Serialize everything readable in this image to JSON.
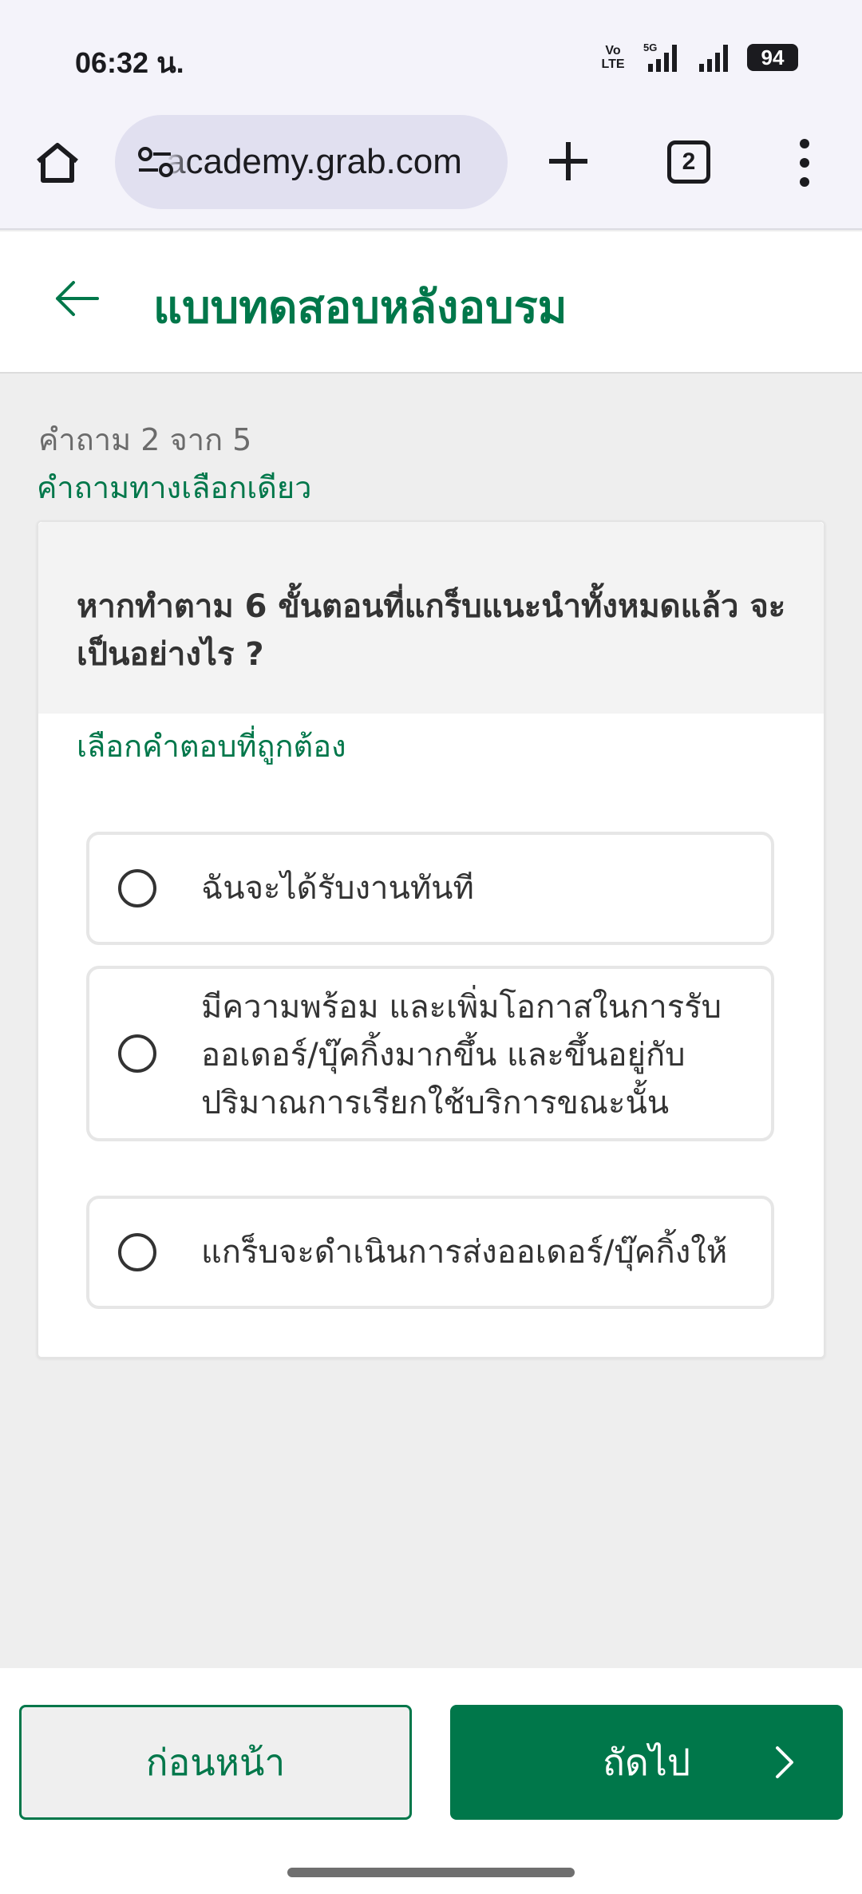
{
  "status_bar": {
    "time": "06:32 น.",
    "volte_label": "Vo LTE",
    "network": "5G",
    "battery": "94"
  },
  "browser": {
    "url": "academy.grab.com",
    "tab_count": "2",
    "icons": {
      "home": "home-icon",
      "site_settings": "tune-icon",
      "new_tab": "plus-icon",
      "menu": "more-vert-icon"
    }
  },
  "header": {
    "title": "แบบทดสอบหลังอบรม",
    "back_icon": "arrow-left-icon"
  },
  "quiz": {
    "counter": "คำถาม 2 จาก 5",
    "type": "คำถามทางเลือกเดียว",
    "question": "หากทำตาม 6 ขั้นตอนที่แกร็บแนะนำทั้งหมดแล้ว จะเป็นอย่างไร ?",
    "instruction": "เลือกคำตอบที่ถูกต้อง",
    "options": [
      {
        "label": "ฉันจะได้รับงานทันที"
      },
      {
        "label": "มีความพร้อม และเพิ่มโอกาสในการรับ ออเดอร์/บุ๊คกิ้งมากขึ้น และขึ้นอยู่กับ ปริมาณการเรียกใช้บริการขณะนั้น"
      },
      {
        "label": "แกร็บจะดำเนินการส่งออเดอร์/บุ๊คกิ้งให้"
      }
    ]
  },
  "footer": {
    "prev_label": "ก่อนหน้า",
    "next_label": "ถัดไป"
  },
  "colors": {
    "brand_green": "#00774a",
    "page_background": "#eeeeee",
    "browser_chrome": "#f4f3fa"
  }
}
